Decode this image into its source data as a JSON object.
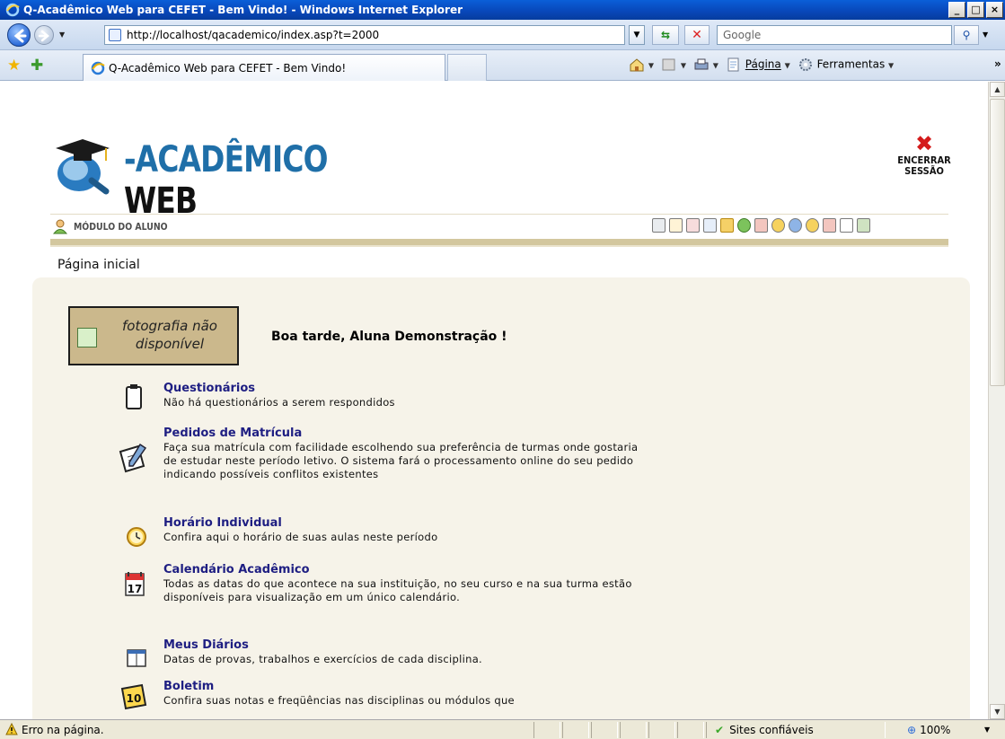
{
  "window": {
    "title": "Q-Acadêmico Web para CEFET - Bem Vindo! - Windows Internet Explorer",
    "minimize": "_",
    "maximize": "□",
    "close": "×"
  },
  "address_bar": {
    "url": "http://localhost/qacademico/index.asp?t=2000",
    "search_placeholder": "Google"
  },
  "tab": {
    "label": "Q-Acadêmico Web para CEFET - Bem Vindo!"
  },
  "command_bar": {
    "page_label": "Página",
    "tools_label": "Ferramentas"
  },
  "header": {
    "logo_text_colored": "-ACADÊMICO",
    "logo_text_dark": "WEB",
    "logout_line1": "ENCERRAR",
    "logout_line2": "SESSÃO"
  },
  "module": {
    "label": "MÓDULO DO ALUNO",
    "icons": [
      "boletim-icon",
      "questionario-icon",
      "diario-icon",
      "matricula-icon",
      "lock-icon",
      "refresh-icon",
      "calendar-icon",
      "clock-icon",
      "shield-icon",
      "clock2-icon",
      "calendar2-icon",
      "note-icon",
      "tools-icon"
    ]
  },
  "breadcrumb": "Página inicial",
  "photo": {
    "placeholder_line1": "fotografia não",
    "placeholder_line2": "disponível"
  },
  "greeting": "Boa tarde, Aluna Demonstração !",
  "items": [
    {
      "title": "Questionários",
      "description": "Não há questionários a serem respondidos",
      "icon": "clipboard-icon"
    },
    {
      "title": "Pedidos de Matrícula",
      "description": "Faça sua matrícula com facilidade escolhendo sua preferência de turmas onde gostaria de estudar neste período letivo. O sistema fará o processamento online do seu pedido indicando possíveis conflitos existentes",
      "icon": "pen-paper-icon"
    },
    {
      "title": "Horário Individual",
      "description": "Confira aqui o horário de suas aulas neste período",
      "icon": "clock-icon"
    },
    {
      "title": "Calendário Acadêmico",
      "description": "Todas as datas do que acontece na sua instituição, no seu curso e na sua turma estão disponíveis para visualização em um único calendário.",
      "icon": "calendar-icon"
    },
    {
      "title": "Meus Diários",
      "description": "Datas de provas, trabalhos e exercícios de cada disciplina.",
      "icon": "diary-icon"
    },
    {
      "title": "Boletim",
      "description": "Confira suas notas e freqüências nas disciplinas ou módulos que",
      "icon": "grade-icon"
    }
  ],
  "calendar_day": "17",
  "grade_number": "10",
  "status_bar": {
    "message": "Erro na página.",
    "zone": "Sites confiáveis",
    "zoom": "100%"
  }
}
